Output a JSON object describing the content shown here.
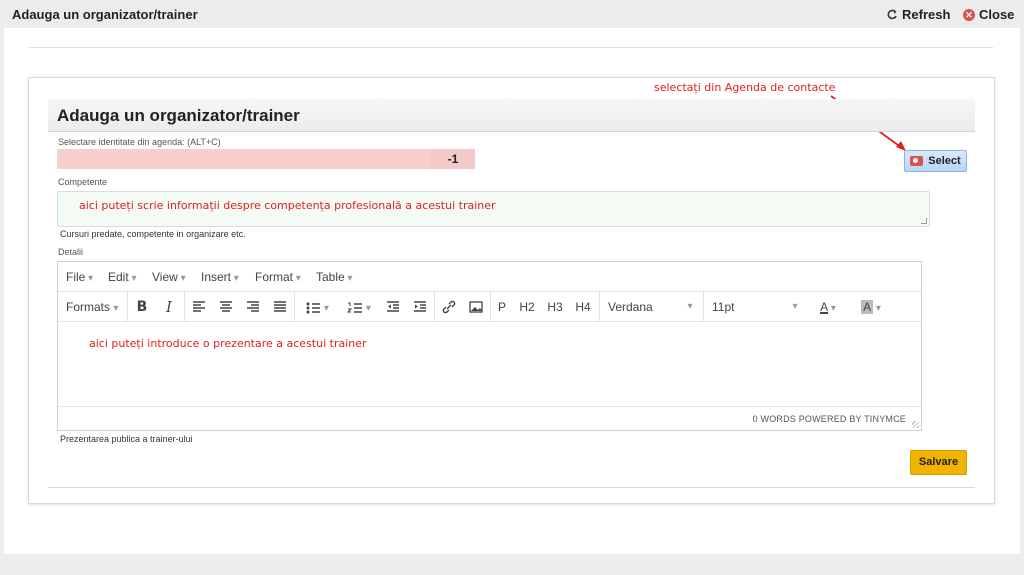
{
  "window": {
    "title": "Adauga un organizator/trainer",
    "refresh_label": "Refresh",
    "close_label": "Close"
  },
  "form": {
    "heading": "Adauga un organizator/trainer",
    "agenda_label": "Selectare identitate din agenda: (ALT+C)",
    "agenda_value": "",
    "agenda_id": "-1",
    "select_label": "Select",
    "select_annotation": "selectați din Agenda de contacte",
    "competente_label": "Competente",
    "competente_hint": "aici puteți scrie informații despre competența profesională a acestui trainer",
    "competente_help": "Cursuri predate, competente in organizare etc.",
    "detalii_label": "Detalii",
    "detalii_hint": "aici puteți introduce o prezentare a acestui trainer",
    "detalii_help": "Prezentarea publica a trainer-ului",
    "save_label": "Salvare"
  },
  "editor": {
    "menu": [
      "File",
      "Edit",
      "View",
      "Insert",
      "Format",
      "Table"
    ],
    "formats_label": "Formats",
    "headings": [
      "P",
      "H2",
      "H3",
      "H4"
    ],
    "font_family": "Verdana",
    "font_size": "11pt",
    "status": "0 WORDS POWERED BY TINYMCE"
  },
  "colors": {
    "accent_save": "#f0b400",
    "annotation_red": "#e02020",
    "agenda_invalid_bg": "#f8cfcf"
  }
}
